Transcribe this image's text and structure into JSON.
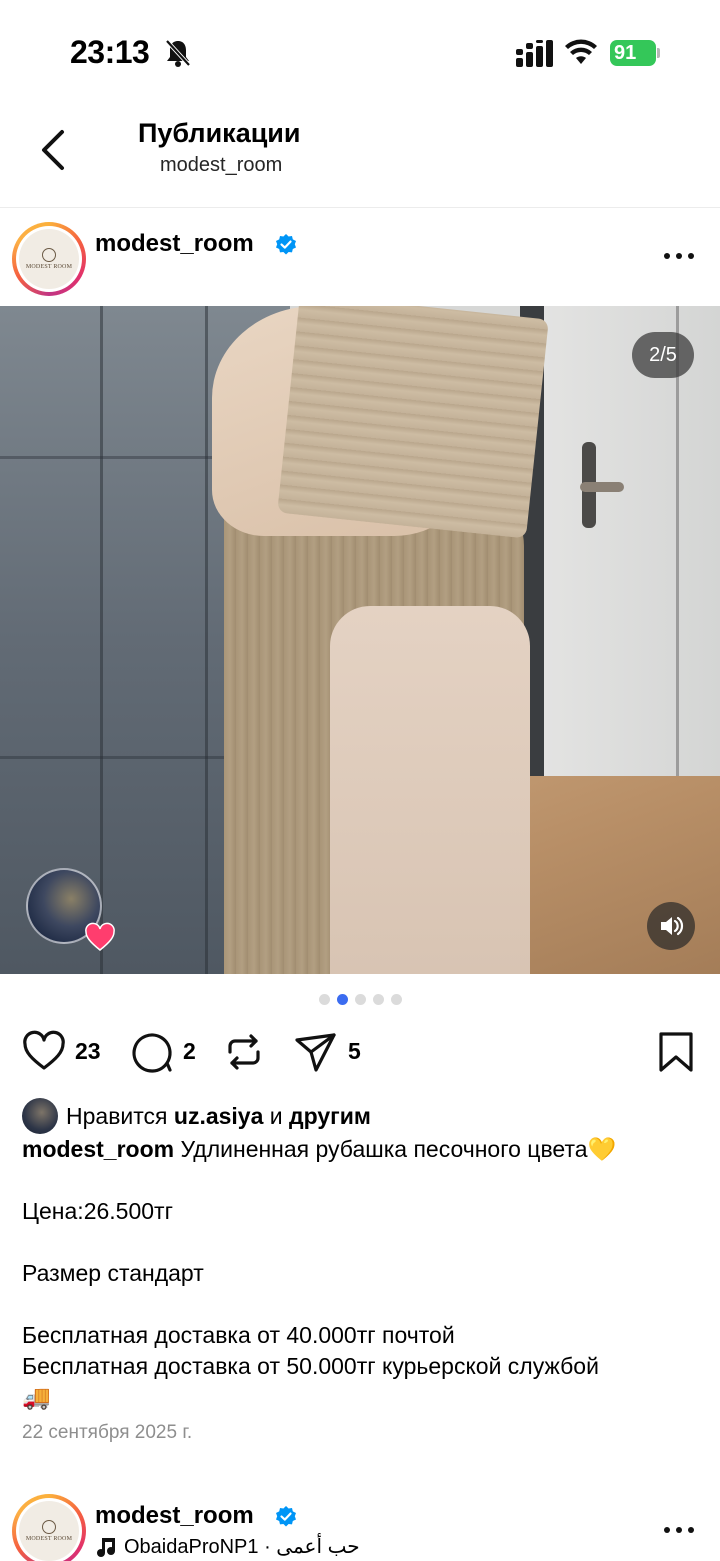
{
  "status_bar": {
    "time": "23:13",
    "battery": "91",
    "icons": [
      "bell-slash-icon",
      "signal-icon",
      "wifi-icon",
      "battery-charging-icon"
    ]
  },
  "header": {
    "title": "Публикации",
    "subtitle": "modest_room"
  },
  "post": {
    "username": "modest_room",
    "verified": true,
    "avatar_brand": "MODEST ROOM",
    "media_counter": "2/5",
    "carousel": {
      "total": 5,
      "active_index": 1
    },
    "actions": {
      "likes_count": "23",
      "comments_count": "2",
      "shares_count": "5"
    },
    "liked_by": {
      "prefix": "Нравится ",
      "user": "uz.asiya",
      "middle": " и ",
      "others": "другим"
    },
    "caption": {
      "username": "modest_room",
      "line1": "Удлиненная рубашка песочного цвета💛",
      "line2": "Цена:26.500тг",
      "line3": "Размер стандарт",
      "line4": "Бесплатная доставка от 40.000тг почтой",
      "line5": "Бесплатная доставка от 50.000тг курьерской службой",
      "line6": "🚚"
    },
    "date": "22 сентября 2025 г."
  },
  "next_post": {
    "username": "modest_room",
    "music": "ObaidaProNP1 · حب أعمى"
  },
  "colors": {
    "accent_blue": "#3b6cf0",
    "verified_blue": "#0095f6",
    "battery_green": "#34c759",
    "muted_text": "#8e8e8e"
  }
}
